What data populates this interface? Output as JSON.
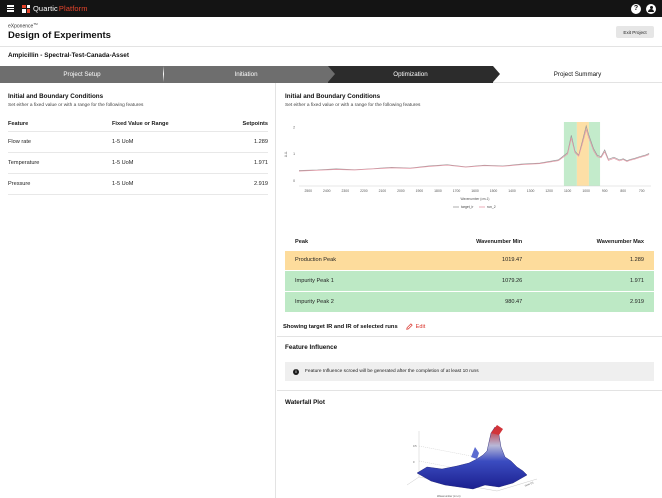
{
  "topbar": {
    "app_name": "Quartic",
    "app_suffix": "Platform",
    "help_icon": "?"
  },
  "header": {
    "brand": "eXponence",
    "brand_tm": "TM",
    "title": "Design of Experiments",
    "exit_label": "Exit Project",
    "asset": "Ampicillin - Spectral-Test-Canada-Asset"
  },
  "steps": [
    "Project Setup",
    "Initiation",
    "Optimization",
    "Project Summary"
  ],
  "left": {
    "title": "Initial and Boundary Conditions",
    "subtitle": "Set either a fixed value or with a range for the following features",
    "headers": [
      "Feature",
      "Fixed Value or Range",
      "Setpoints"
    ],
    "rows": [
      {
        "feature": "Flow rate",
        "range": "1-5 UoM",
        "setpoint": "1.289"
      },
      {
        "feature": "Temperature",
        "range": "1-5 UoM",
        "setpoint": "1.971"
      },
      {
        "feature": "Pressure",
        "range": "1-5 UoM",
        "setpoint": "2.919"
      }
    ]
  },
  "right": {
    "title": "Initial and Boundary Conditions",
    "subtitle": "Set either a fixed value or with a range for the following features",
    "peak_headers": [
      "Peak",
      "Wavenumber Min",
      "Wavenumber Max"
    ],
    "peaks": [
      {
        "name": "Production Peak",
        "min": "1019.47",
        "max": "1.289"
      },
      {
        "name": "Impurity Peak 1",
        "min": "1079.26",
        "max": "1.971"
      },
      {
        "name": "Impurity Peak 2",
        "min": "980.47",
        "max": "2.919"
      }
    ],
    "showing": "Showing target IR and IR of selected runs",
    "edit_label": "Edit",
    "feature_influence_title": "Feature Influence",
    "feature_influence_note": "Feature Influence scroed will be generated after the completion of at least 10 runs",
    "info_icon": "i",
    "waterfall_title": "Waterfall Plot"
  },
  "colors": {
    "accent": "#e8452c",
    "production": "#fddc9c",
    "impurity": "#bde9c5",
    "edit": "#d9332b"
  },
  "chart_data": {
    "type": "line",
    "xlabel": "Wavenumber (cm-1)",
    "ylabel": "A.U.",
    "x_ticks": [
      "2500",
      "2400",
      "2300",
      "2200",
      "2100",
      "2000",
      "1900",
      "1800",
      "1700",
      "1600",
      "1500",
      "1400",
      "1300",
      "1200",
      "1100",
      "1000",
      "900",
      "800",
      "700"
    ],
    "y_ticks": [
      "0",
      "1",
      "2"
    ],
    "xlim": [
      2550,
      650
    ],
    "ylim": [
      -0.2,
      2.2
    ],
    "bands": [
      {
        "from": 1120,
        "to": 1050,
        "color": "#bde9c5"
      },
      {
        "from": 1050,
        "to": 985,
        "color": "#fddc9c"
      },
      {
        "from": 985,
        "to": 925,
        "color": "#bde9c5"
      }
    ],
    "series": [
      {
        "name": "target_ir",
        "color": "#9a9a9a",
        "x": [
          2550,
          2450,
          2350,
          2250,
          2150,
          2050,
          1950,
          1850,
          1750,
          1650,
          1550,
          1450,
          1350,
          1250,
          1150,
          1100,
          1080,
          1060,
          1040,
          1020,
          1000,
          985,
          960,
          940,
          920,
          900,
          880,
          850,
          820,
          800,
          780,
          760,
          740,
          720,
          700,
          680,
          660
        ],
        "y": [
          0.38,
          0.4,
          0.44,
          0.41,
          0.45,
          0.5,
          0.47,
          0.55,
          0.6,
          0.52,
          0.58,
          0.55,
          0.62,
          0.66,
          0.78,
          1.05,
          1.7,
          1.1,
          0.95,
          1.5,
          2.05,
          1.7,
          1.2,
          0.95,
          0.9,
          1.15,
          0.8,
          0.88,
          0.78,
          0.82,
          0.75,
          0.8,
          0.83,
          0.88,
          0.92,
          0.96,
          1.02
        ]
      },
      {
        "name": "run_2",
        "color": "#e79aa8",
        "x": [
          2550,
          2450,
          2350,
          2250,
          2150,
          2050,
          1950,
          1850,
          1750,
          1650,
          1550,
          1450,
          1350,
          1250,
          1150,
          1100,
          1080,
          1060,
          1040,
          1020,
          1000,
          985,
          960,
          940,
          920,
          900,
          880,
          850,
          820,
          800,
          780,
          760,
          740,
          720,
          700,
          680,
          660
        ],
        "y": [
          0.36,
          0.39,
          0.42,
          0.4,
          0.44,
          0.48,
          0.46,
          0.53,
          0.58,
          0.51,
          0.56,
          0.54,
          0.6,
          0.64,
          0.75,
          1.0,
          1.6,
          1.05,
          0.92,
          1.4,
          1.92,
          1.6,
          1.12,
          0.9,
          0.86,
          1.08,
          0.76,
          0.84,
          0.74,
          0.79,
          0.72,
          0.77,
          0.8,
          0.85,
          0.89,
          0.93,
          0.98
        ]
      }
    ],
    "legend": "bottom"
  }
}
